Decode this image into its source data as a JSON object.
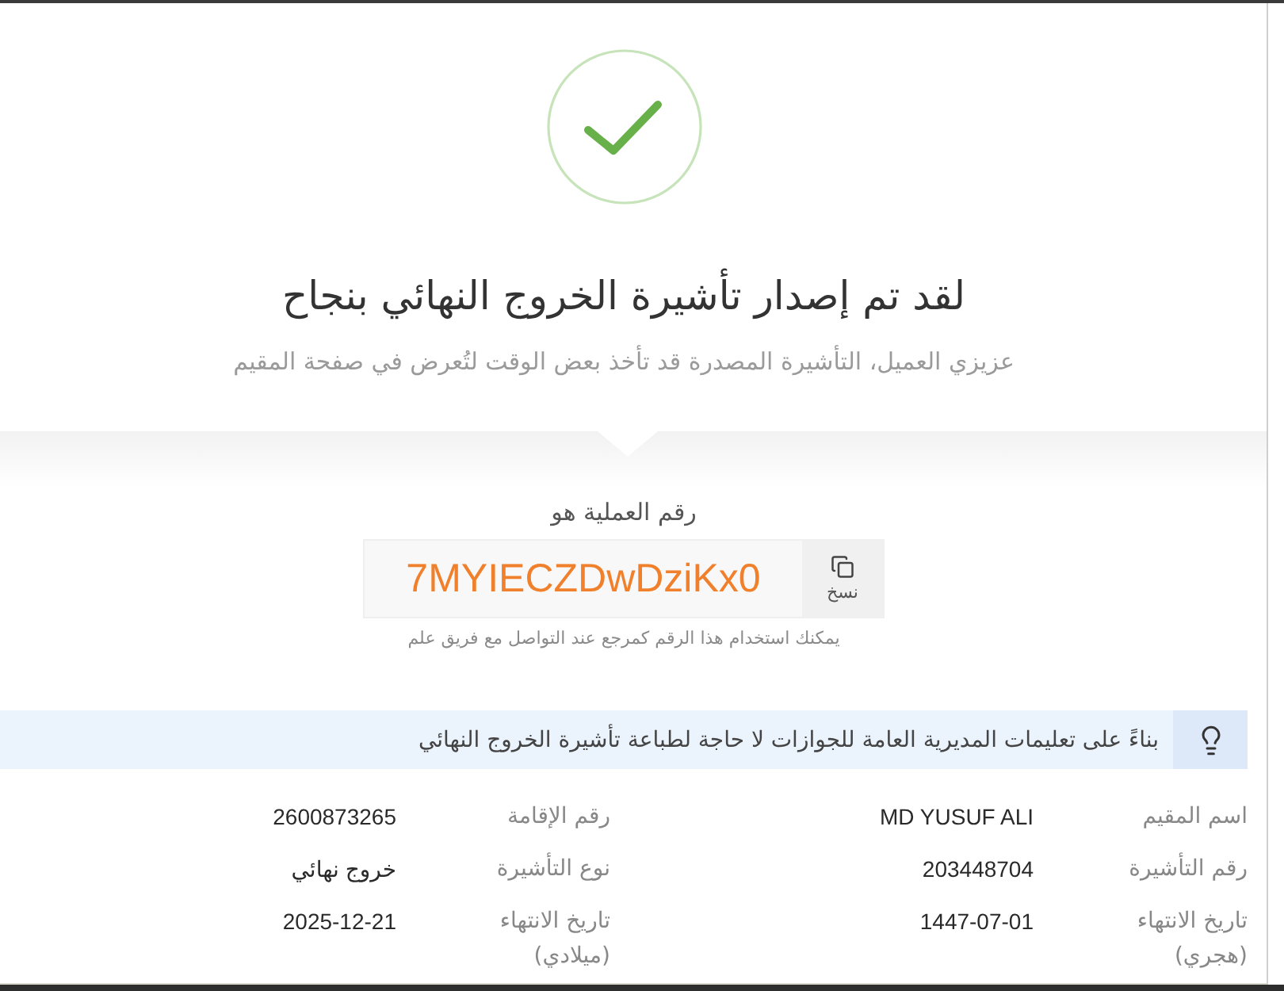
{
  "success": {
    "title": "لقد تم إصدار تأشيرة الخروج النهائي بنجاح",
    "subtitle": "عزيزي العميل، التأشيرة المصدرة قد تأخذ بعض الوقت لتُعرض في صفحة المقيم"
  },
  "transaction": {
    "label": "رقم العملية هو",
    "code": "7MYIECZDwDziKx0",
    "copy_button": "نسخ",
    "hint": "يمكنك استخدام هذا الرقم كمرجع عند التواصل مع فريق علم"
  },
  "notice": {
    "text": "بناءً على تعليمات المديرية العامة للجوازات لا حاجة لطباعة تأشيرة الخروج النهائي"
  },
  "details": [
    {
      "label": "اسم المقيم",
      "value": "MD YUSUF ALI"
    },
    {
      "label": "رقم الإقامة",
      "value": "2600873265"
    },
    {
      "label": "رقم التأشيرة",
      "value": "203448704"
    },
    {
      "label": "نوع التأشيرة",
      "value": "خروج نهائي"
    },
    {
      "label": "تاريخ الانتهاء (هجري)",
      "value": "1447-07-01"
    },
    {
      "label": "تاريخ الانتهاء (ميلادي)",
      "value": "2025-12-21"
    }
  ]
}
